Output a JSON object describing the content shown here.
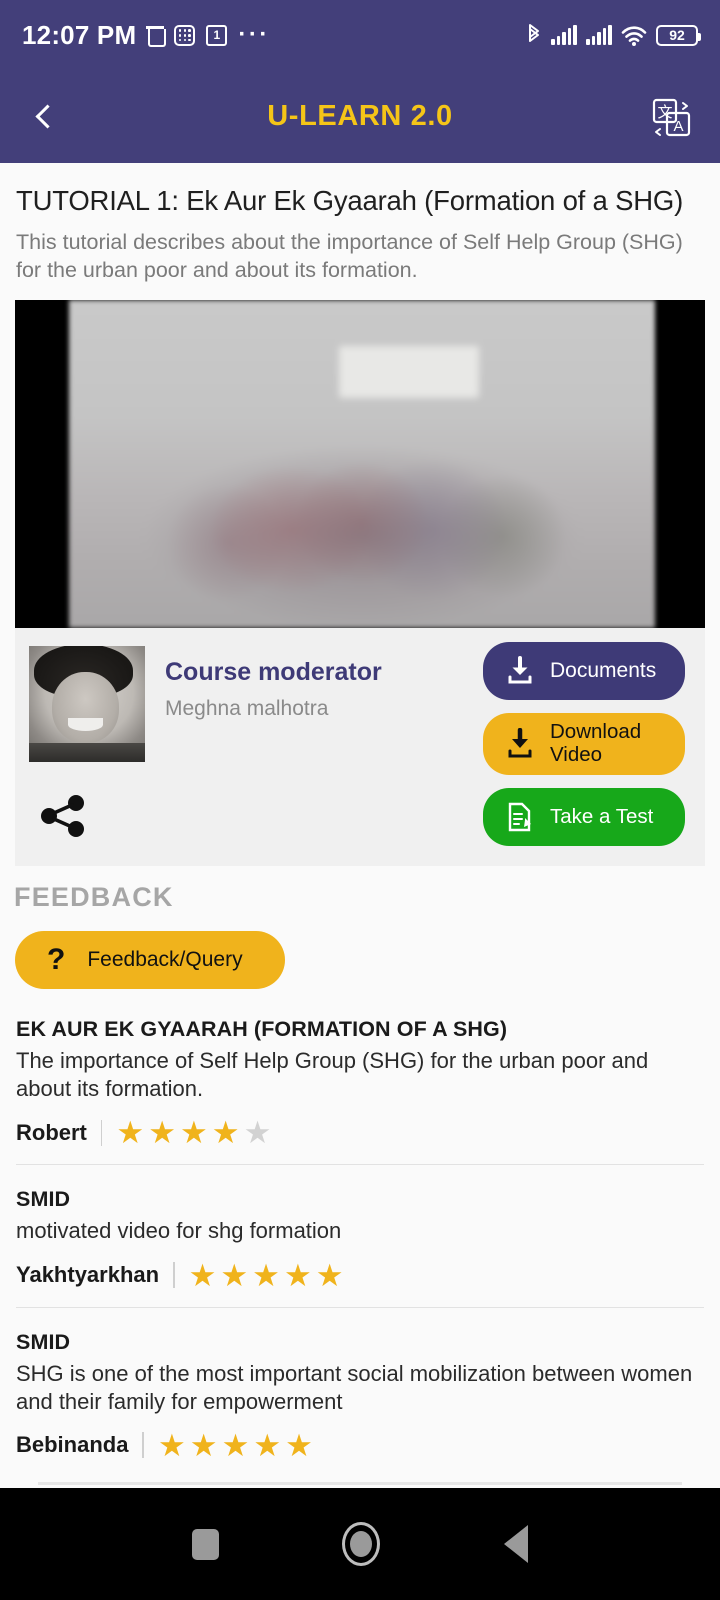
{
  "status_bar": {
    "time": "12:07 PM",
    "battery_percent": "92",
    "notification_count": "1",
    "wifi_generation": "6",
    "icons": [
      "trash-icon",
      "calculator-icon",
      "notification-box-icon",
      "overflow-dots-icon",
      "bluetooth-icon",
      "signal-bars-icon",
      "signal-bars-icon-2",
      "wifi-icon",
      "battery-icon"
    ]
  },
  "app_bar": {
    "title": "U-LEARN 2.0",
    "back_icon": "back-chevron-icon",
    "translate_icon": "translate-icon"
  },
  "tutorial": {
    "title": "TUTORIAL 1: Ek Aur Ek Gyaarah (Formation of a SHG)",
    "description": "This tutorial describes about the importance of Self Help Group (SHG) for the urban poor and about its formation."
  },
  "moderator": {
    "role_label": "Course moderator",
    "name": "Meghna malhotra",
    "share_icon": "share-icon",
    "avatar": "moderator-avatar"
  },
  "action_buttons": [
    {
      "label": "Documents",
      "icon": "download-icon",
      "color": "#3e3a77"
    },
    {
      "label": "Download\nVideo",
      "line1": "Download",
      "line2": "Video",
      "icon": "download-icon",
      "color": "#f0b31c"
    },
    {
      "label": "Take a Test",
      "icon": "test-document-icon",
      "color": "#17a81a"
    }
  ],
  "feedback": {
    "section_title": "FEEDBACK",
    "button_label": "Feedback/Query",
    "button_icon": "question-mark-icon"
  },
  "reviews": [
    {
      "title": "EK AUR EK GYAARAH (FORMATION OF A SHG)",
      "body": "The importance of Self Help Group (SHG) for the urban poor and about its formation.",
      "user": "Robert",
      "rating": 4,
      "max_rating": 5
    },
    {
      "title": "SMID",
      "body": "motivated video for shg formation",
      "user": "Yakhtyarkhan",
      "rating": 5,
      "max_rating": 5
    },
    {
      "title": "SMID",
      "body": "SHG is one of the most important social mobilization between women and their family for empowerment",
      "user": "Bebinanda",
      "rating": 5,
      "max_rating": 5
    }
  ],
  "nav_bar": {
    "recents_label": "recents-square-icon",
    "home_label": "home-circle-icon",
    "back_label": "back-triangle-icon"
  },
  "colors": {
    "header_purple": "#433f7a",
    "accent_gold": "#f5c518",
    "button_amber": "#f0b31c",
    "button_green": "#17a81a",
    "star_gold": "#f0b31c",
    "star_off": "#d2d2d2"
  }
}
